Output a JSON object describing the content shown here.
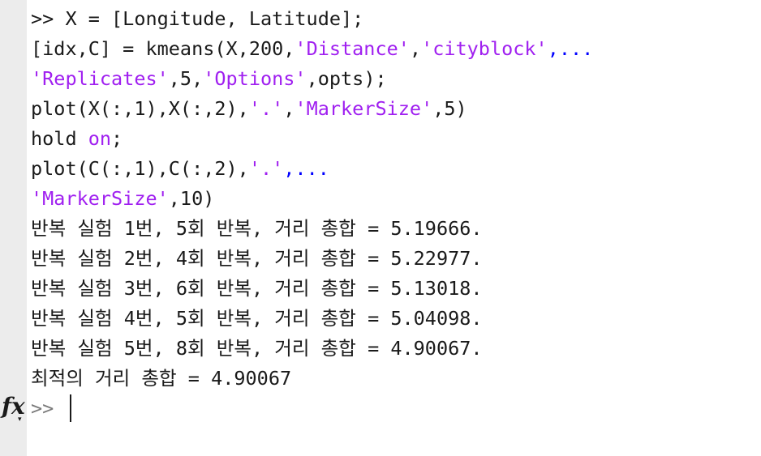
{
  "console": {
    "lines": [
      [
        {
          "t": ">> X = [Longitude, Latitude];",
          "c": ""
        }
      ],
      [
        {
          "t": "[idx,C] = kmeans(X,200,",
          "c": ""
        },
        {
          "t": "'Distance'",
          "c": "str"
        },
        {
          "t": ",",
          "c": ""
        },
        {
          "t": "'cityblock'",
          "c": "str"
        },
        {
          "t": ",...",
          "c": "cont"
        }
      ],
      [
        {
          "t": "'Replicates'",
          "c": "str"
        },
        {
          "t": ",5,",
          "c": ""
        },
        {
          "t": "'Options'",
          "c": "str"
        },
        {
          "t": ",opts);",
          "c": ""
        }
      ],
      [
        {
          "t": "plot(X(:,1),X(:,2),",
          "c": ""
        },
        {
          "t": "'.'",
          "c": "str"
        },
        {
          "t": ",",
          "c": ""
        },
        {
          "t": "'MarkerSize'",
          "c": "str"
        },
        {
          "t": ",5)",
          "c": ""
        }
      ],
      [
        {
          "t": "hold ",
          "c": ""
        },
        {
          "t": "on",
          "c": "str"
        },
        {
          "t": ";",
          "c": ""
        }
      ],
      [
        {
          "t": "plot(C(:,1),C(:,2),",
          "c": ""
        },
        {
          "t": "'.'",
          "c": "str"
        },
        {
          "t": ",...",
          "c": "cont"
        }
      ],
      [
        {
          "t": "'MarkerSize'",
          "c": "str"
        },
        {
          "t": ",10)",
          "c": ""
        }
      ],
      [
        {
          "t": "반복 실험 1번, 5회 반복, 거리 총합 = 5.19666.",
          "c": ""
        }
      ],
      [
        {
          "t": "반복 실험 2번, 4회 반복, 거리 총합 = 5.22977.",
          "c": ""
        }
      ],
      [
        {
          "t": "반복 실험 3번, 6회 반복, 거리 총합 = 5.13018.",
          "c": ""
        }
      ],
      [
        {
          "t": "반복 실험 4번, 5회 반복, 거리 총합 = 5.04098.",
          "c": ""
        }
      ],
      [
        {
          "t": "반복 실험 5번, 8회 반복, 거리 총합 = 4.90067.",
          "c": ""
        }
      ],
      [
        {
          "t": "최적의 거리 총합 = 4.90067",
          "c": ""
        }
      ]
    ],
    "prompt": ">>",
    "fx_label": "fx"
  },
  "colors": {
    "background": "#ffffff",
    "gutter": "#ececec",
    "text": "#1a1a1a",
    "string": "#a020f0",
    "keyword": "#0000ff",
    "prompt": "#7a7a7a"
  },
  "icons": {
    "function_browser": "fx-icon"
  }
}
